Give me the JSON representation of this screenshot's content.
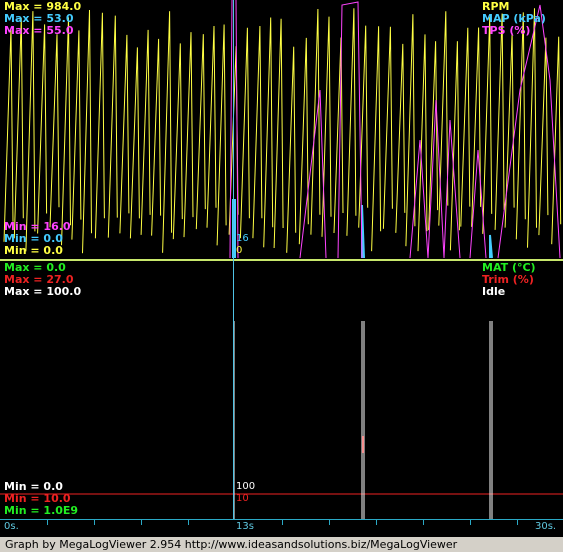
{
  "upper": {
    "max_labels": [
      {
        "text": "Max = 984.0",
        "color": "#ffff44"
      },
      {
        "text": "Max = 53.0",
        "color": "#44ccff"
      },
      {
        "text": "Max = 55.0",
        "color": "#ff44ff"
      }
    ],
    "min_labels": [
      {
        "text": "Min = 16.0",
        "color": "#ff44ff"
      },
      {
        "text": "Min = 0.0",
        "color": "#44ccff"
      },
      {
        "text": "Min = 0.0",
        "color": "#ffff44"
      }
    ],
    "legend": [
      {
        "text": "RPM",
        "color": "#ffff44"
      },
      {
        "text": "MAP (kPa)",
        "color": "#44ccff"
      },
      {
        "text": "TPS (%)",
        "color": "#ff44ff"
      }
    ],
    "cursor_values": [
      {
        "text": "16",
        "color": "#44ccff"
      },
      {
        "text": "0",
        "color": "#ffff44"
      }
    ]
  },
  "lower": {
    "max_labels": [
      {
        "text": "Max = 0.0",
        "color": "#22ee22"
      },
      {
        "text": "Max = 27.0",
        "color": "#ee2222"
      },
      {
        "text": "Max = 100.0",
        "color": "#ffffff"
      }
    ],
    "min_labels": [
      {
        "text": "Min = 0.0",
        "color": "#ffffff"
      },
      {
        "text": "Min = 10.0",
        "color": "#ee2222"
      },
      {
        "text": "Min = 1.0E9",
        "color": "#22ee22"
      }
    ],
    "legend": [
      {
        "text": "MAT (°C)",
        "color": "#22ee22"
      },
      {
        "text": "Trim (%)",
        "color": "#ee2222"
      },
      {
        "text": "Idle",
        "color": "#ffffff"
      }
    ],
    "cursor_values": [
      {
        "text": "100",
        "color": "#ffffff"
      },
      {
        "text": "10",
        "color": "#ee2222"
      }
    ]
  },
  "time_axis": {
    "start": "0s.",
    "cursor": "13s",
    "end": "30s."
  },
  "footer": {
    "text": "Graph by MegaLogViewer 2.954 http://www.ideasandsolutions.biz/MegaLogViewer"
  },
  "colors": {
    "rpm": "#ffff44",
    "map": "#44ccff",
    "tps": "#ff44ff",
    "mat": "#22ee22",
    "trim": "#ee2222",
    "idle": "#ffffff",
    "divider": "#c8e86c",
    "cursor": "#4fc3e6"
  }
}
